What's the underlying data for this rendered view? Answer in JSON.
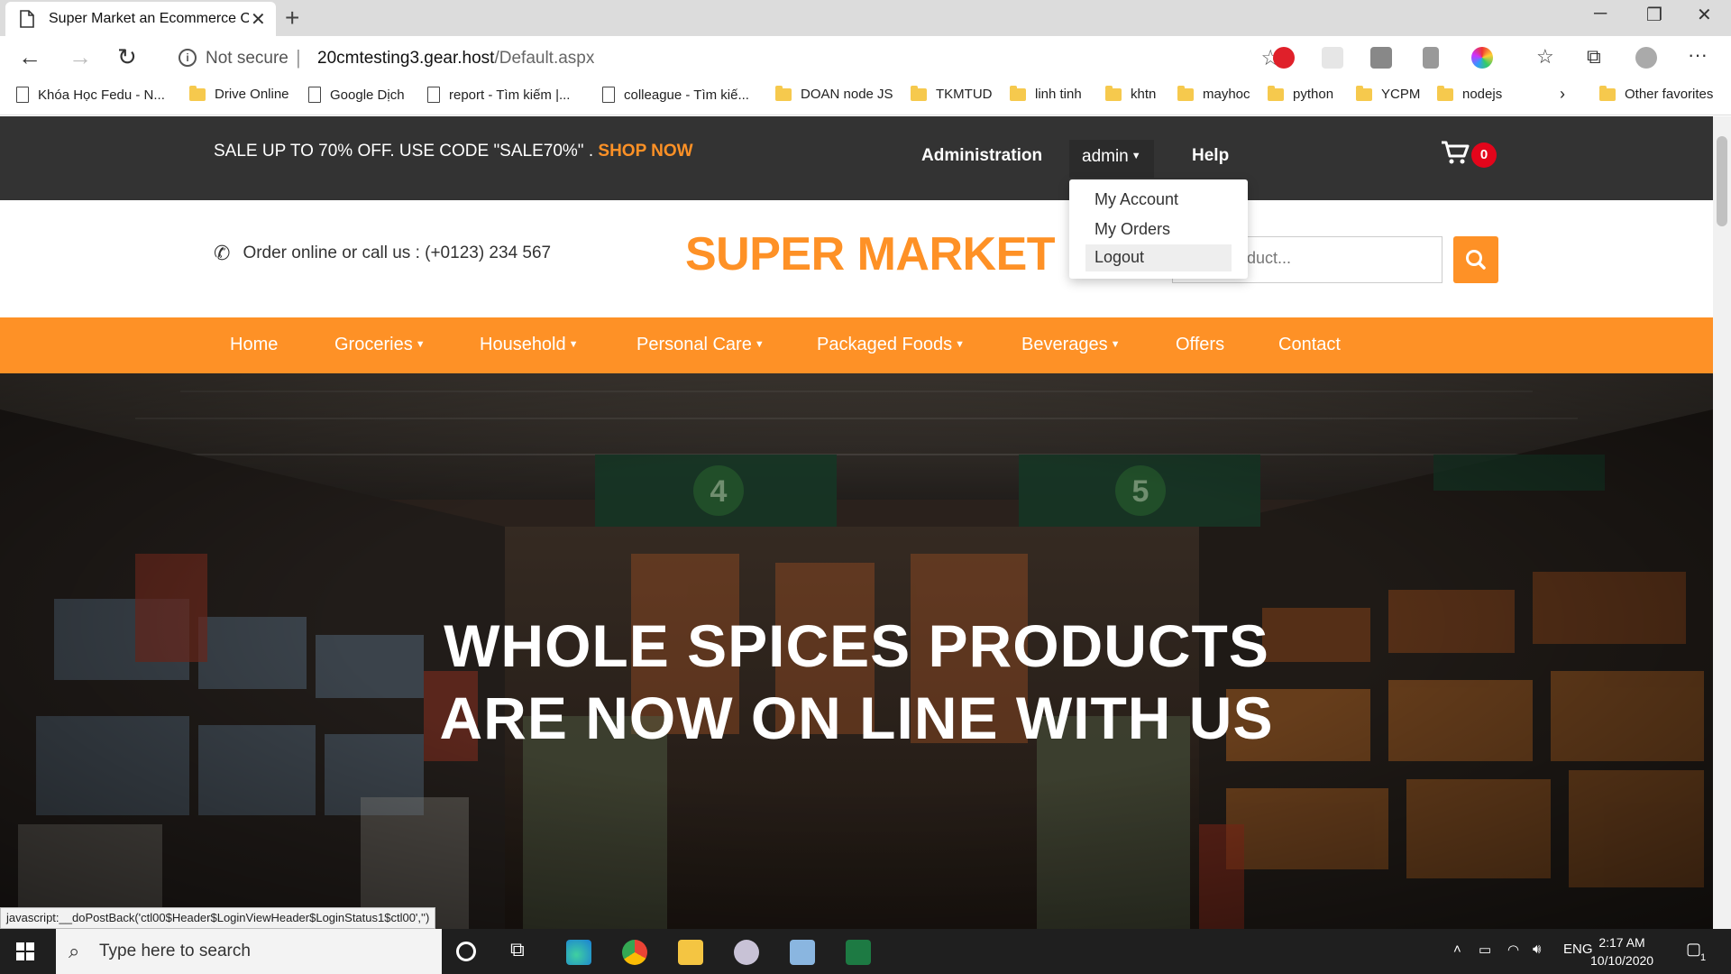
{
  "browser": {
    "tab_title": "Super Market an Ecommerce Onl",
    "url_security": "Not secure",
    "url_host": "20cmtesting3.gear.host",
    "url_path": "/Default.aspx",
    "bookmarks": [
      "Khóa Học Fedu - N...",
      "Drive Online",
      "Google Dịch",
      "report - Tìm kiếm |...",
      "colleague - Tìm kiế...",
      "DOAN node JS",
      "TKMTUD",
      "linh tinh",
      "khtn",
      "mayhoc",
      "python",
      "YCPM",
      "nodejs"
    ],
    "other_favorites": "Other favorites",
    "status_text": "javascript:__doPostBack('ctl00$Header$LoginViewHeader$LoginStatus1$ctl00','')"
  },
  "topbar": {
    "promo_text": "SALE UP TO 70% OFF. USE CODE \"SALE70%\" .",
    "promo_link": "SHOP NOW",
    "admin_link": "Administration",
    "user_menu": "admin",
    "help_link": "Help",
    "cart_count": "0"
  },
  "user_dropdown": [
    "My Account",
    "My Orders",
    "Logout"
  ],
  "header": {
    "contact": "Order online or call us : (+0123) 234 567",
    "logo": "SUPER MARKET",
    "search_placeholder": "or a Product..."
  },
  "nav": {
    "home": "Home",
    "groceries": "Groceries",
    "household": "Household",
    "personal_care": "Personal Care",
    "packaged_foods": "Packaged Foods",
    "beverages": "Beverages",
    "offers": "Offers",
    "contact": "Contact"
  },
  "hero": {
    "line1": "WHOLE SPICES PRODUCTS",
    "line2": "ARE NOW ON LINE WITH US",
    "aisle_numbers": [
      "4",
      "5"
    ]
  },
  "taskbar": {
    "search_placeholder": "Type here to search",
    "lang": "ENG",
    "time": "2:17 AM",
    "date": "10/10/2020",
    "notifications": "1"
  },
  "colors": {
    "accent": "#fe9126",
    "topbar": "#333333",
    "badge": "#e3051b"
  }
}
